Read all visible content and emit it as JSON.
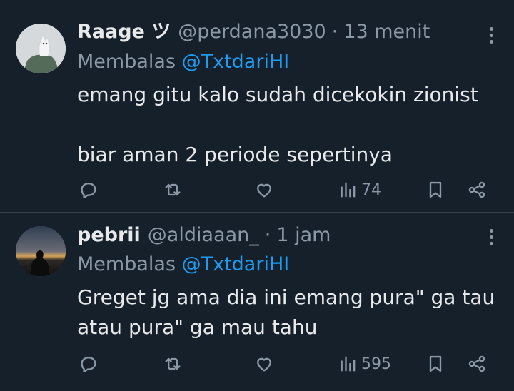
{
  "tweets": [
    {
      "name": "Raage ツ",
      "handle": "@perdana3030",
      "separator": "·",
      "time": "13 menit",
      "reply_prefix": "Membalas",
      "reply_to": "@TxtdariHI",
      "text": "emang gitu kalo sudah dicekokin zionist\n\nbiar aman 2 periode sepertinya",
      "views": "74"
    },
    {
      "name": "pebrii",
      "handle": "@aldiaaan_",
      "separator": "·",
      "time": "1 jam",
      "reply_prefix": "Membalas",
      "reply_to": "@TxtdariHI",
      "text": "Greget jg ama dia ini emang pura\" ga tau\natau pura\" ga mau tahu",
      "views": "595"
    }
  ],
  "icons": [
    "reply-icon",
    "repost-icon",
    "like-icon",
    "views-icon",
    "bookmark-icon",
    "share-icon",
    "more-icon"
  ],
  "colors": {
    "background": "#15202b",
    "text": "#e7e9ea",
    "secondary": "#8b98a5",
    "link": "#1d9bf0",
    "divider": "#38444d"
  }
}
